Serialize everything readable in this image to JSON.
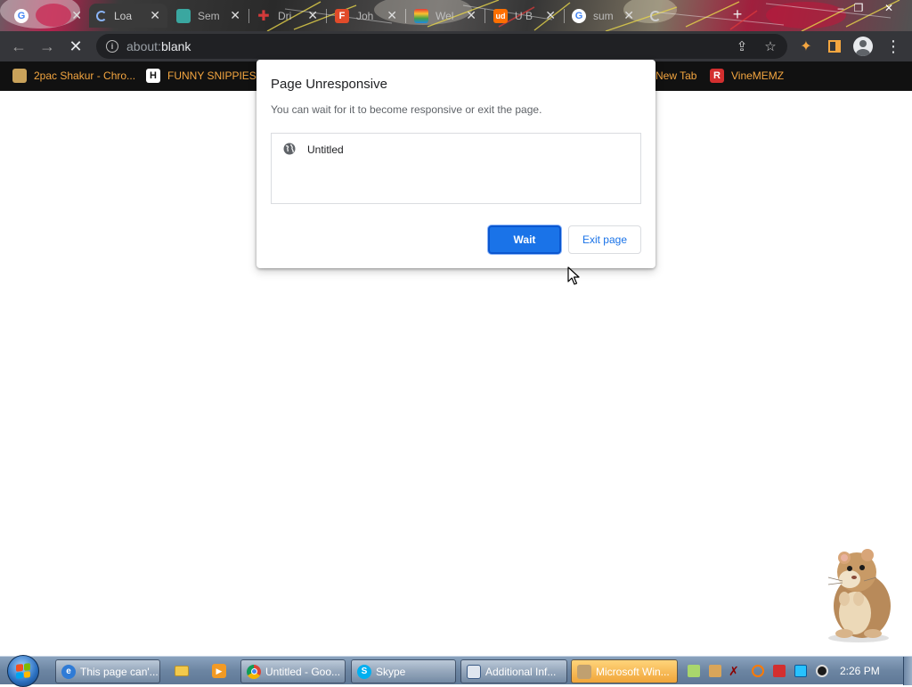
{
  "browser": {
    "tabs": [
      {
        "title": "",
        "icon": "google-icon",
        "color": "#ffffff",
        "active": false
      },
      {
        "title": "Loa",
        "icon": "loading-icon",
        "color": "#8ab4f8",
        "active": true
      },
      {
        "title": "Sem",
        "icon": "sem-icon",
        "color": "#3aa7a0",
        "active": false
      },
      {
        "title": "Dri",
        "icon": "plus-cross-icon",
        "color": "#d33a3a",
        "active": false
      },
      {
        "title": "Joh",
        "icon": "f-icon",
        "color": "#e14b2a",
        "active": false
      },
      {
        "title": "Wel",
        "icon": "rainbow-icon",
        "color": "#ffb300",
        "active": false
      },
      {
        "title": "U B",
        "icon": "ud-icon",
        "color": "#ff6f00",
        "active": false
      },
      {
        "title": "sum",
        "icon": "google-icon",
        "color": "#ffffff",
        "active": false
      }
    ],
    "window_controls": {
      "minimize": "–",
      "maximize": "❐",
      "close": "✕"
    }
  },
  "toolbar": {
    "url_scheme": "about:",
    "url_host": "blank"
  },
  "bookmarks": [
    {
      "label": "2pac Shakur - Chro...",
      "icon": "2pac-icon"
    },
    {
      "label": "FUNNY SNIPPIES",
      "icon": "h-icon"
    },
    {
      "label": "New Tab",
      "icon": "new-tab-icon"
    },
    {
      "label": "VineMEMZ",
      "icon": "r-icon"
    }
  ],
  "dialog": {
    "title": "Page Unresponsive",
    "message": "You can wait for it to become responsive or exit the page.",
    "pages": [
      {
        "title": "Untitled"
      }
    ],
    "wait_label": "Wait",
    "exit_label": "Exit page"
  },
  "taskbar": {
    "tasks": [
      {
        "label": "This page can'...",
        "icon": "ie-icon",
        "active": false
      },
      {
        "label": "Untitled - Goo...",
        "icon": "chrome-icon",
        "active": false
      },
      {
        "label": "Skype",
        "icon": "skype-icon",
        "active": false
      },
      {
        "label": "Additional Inf...",
        "icon": "window-icon",
        "active": false
      },
      {
        "label": "Microsoft Win...",
        "icon": "agent-icon",
        "active": true
      }
    ],
    "clock": "2:26 PM"
  },
  "colors": {
    "accent_blue": "#1a73e8",
    "bookmark_text": "#f4a640",
    "toolbar_bg": "#35363a",
    "omnibox_bg": "#202124"
  }
}
